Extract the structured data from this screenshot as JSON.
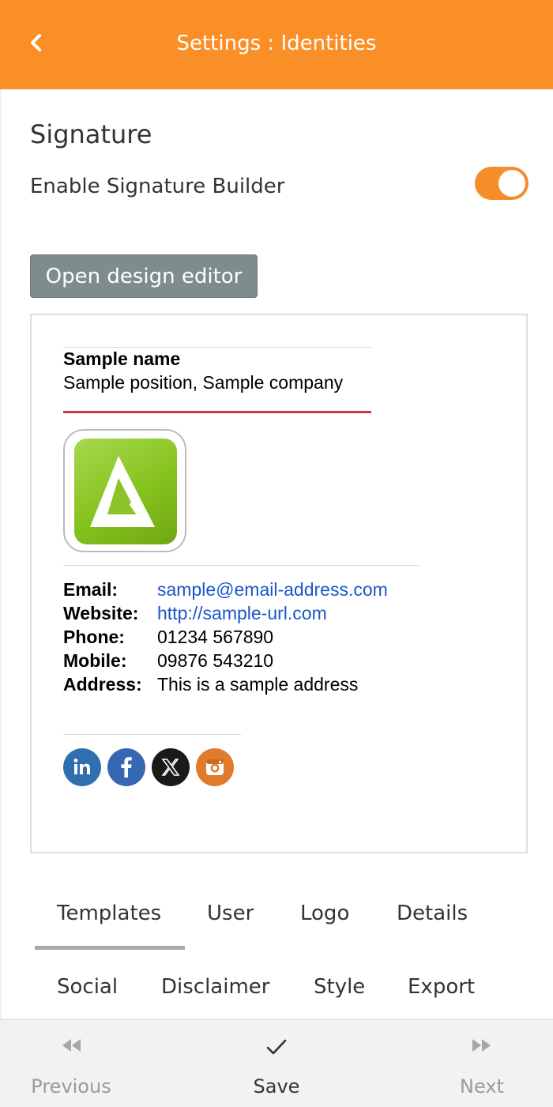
{
  "header": {
    "title": "Settings : Identities",
    "back_icon": "chevron-left-icon"
  },
  "signature": {
    "section_title": "Signature",
    "toggle_label": "Enable Signature Builder",
    "toggle_on": true,
    "design_button": "Open design editor"
  },
  "preview": {
    "name": "Sample name",
    "position": "Sample position, Sample company",
    "details": [
      {
        "label": "Email:",
        "value": "sample@email-address.com",
        "link": true
      },
      {
        "label": "Website:",
        "value": "http://sample-url.com",
        "link": true
      },
      {
        "label": "Phone:",
        "value": "01234 567890",
        "link": false
      },
      {
        "label": "Mobile:",
        "value": "09876 543210",
        "link": false
      },
      {
        "label": "Address:",
        "value": "This is a sample address",
        "link": false
      }
    ],
    "social": [
      {
        "name": "linkedin-icon",
        "glyph": "in",
        "color": "#2f6fb0"
      },
      {
        "name": "facebook-icon",
        "glyph": "f",
        "color": "#3567b2"
      },
      {
        "name": "x-icon",
        "glyph": "X",
        "color": "#1a1a1a"
      },
      {
        "name": "instagram-icon",
        "glyph": "",
        "color": "#e07b2e"
      }
    ]
  },
  "tabs": {
    "row1": [
      "Templates",
      "User",
      "Logo",
      "Details"
    ],
    "row2": [
      "Social",
      "Disclaimer",
      "Style",
      "Export"
    ],
    "active": "Templates"
  },
  "footer": {
    "previous": "Previous",
    "save": "Save",
    "next": "Next"
  },
  "colors": {
    "accent": "#fa8f28",
    "button_grey": "#7f8c8d",
    "link": "#1a56c8",
    "divider_red": "#c83c3c"
  }
}
